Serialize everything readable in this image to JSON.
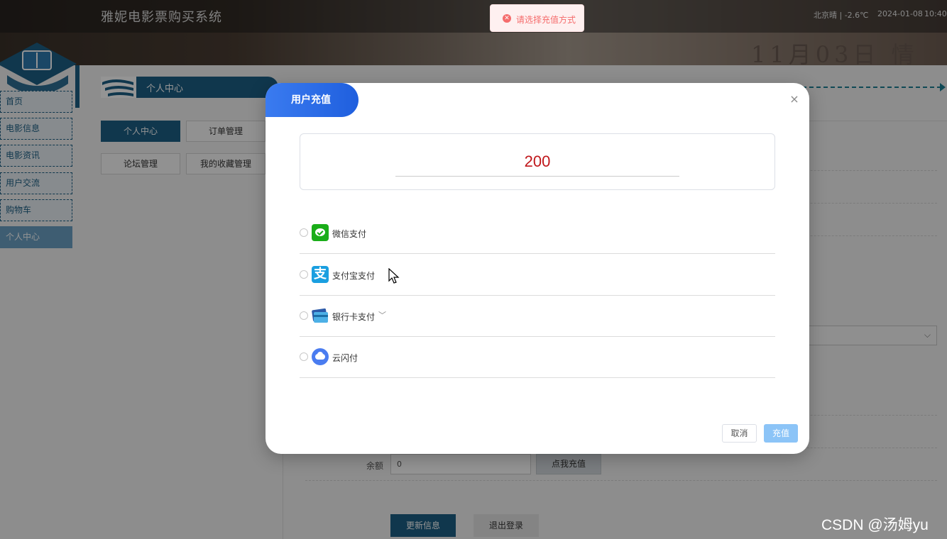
{
  "header": {
    "site_title": "雅妮电影票购买系统",
    "weather": "北京晴 | -2.6℃",
    "date": "2024-01-08",
    "time": "10:40:",
    "marquee": "11月03日 情"
  },
  "sidebar": {
    "items": [
      {
        "label": "首页",
        "active": false
      },
      {
        "label": "电影信息",
        "active": false
      },
      {
        "label": "电影资讯",
        "active": false
      },
      {
        "label": "用户交流",
        "active": false
      },
      {
        "label": "购物车",
        "active": false
      },
      {
        "label": "个人中心",
        "active": true
      }
    ]
  },
  "section": {
    "title": "个人中心"
  },
  "tabs": [
    {
      "label": "个人中心",
      "active": true
    },
    {
      "label": "订单管理",
      "active": false
    },
    {
      "label": "论坛管理",
      "active": false
    },
    {
      "label": "我的收藏管理",
      "active": false
    }
  ],
  "profile": {
    "balance_label": "余额",
    "balance_value": "0",
    "recharge_button": "点我充值",
    "update_button": "更新信息",
    "logout_button": "退出登录"
  },
  "toast": {
    "message": "请选择充值方式",
    "type": "error"
  },
  "dialog": {
    "title": "用户充值",
    "amount": "200",
    "payment_methods": [
      {
        "label": "微信支付",
        "icon": "wechat-pay-icon",
        "selected": false
      },
      {
        "label": "支付宝支付",
        "icon": "alipay-icon",
        "selected": false
      },
      {
        "label": "银行卡支付",
        "icon": "bank-card-icon",
        "selected": false,
        "has_dropdown": true
      },
      {
        "label": "云闪付",
        "icon": "cloud-pay-icon",
        "selected": false
      }
    ],
    "cancel_button": "取消",
    "confirm_button": "充值"
  },
  "watermark": "CSDN @汤姆yu",
  "colors": {
    "primary": "#1d5f85",
    "dialog_title": "#1f5fde",
    "amount_text": "#c0171b",
    "confirm_button": "#8cc4f7",
    "toast_error": "#f56c6c"
  }
}
